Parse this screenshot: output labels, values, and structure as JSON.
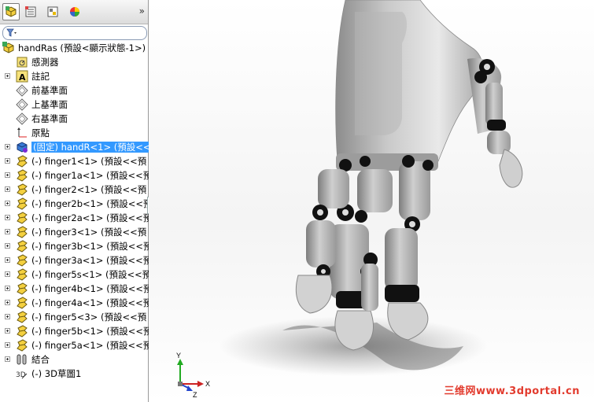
{
  "feature_manager": {
    "tabs": [
      {
        "name": "feature-tree-tab-icon"
      },
      {
        "name": "property-tab-icon"
      },
      {
        "name": "configuration-tab-icon"
      },
      {
        "name": "display-tab-icon"
      }
    ],
    "expand_label": "»",
    "tree": [
      {
        "label": "handRas  (預設<顯示狀態-1>)",
        "icon": "assembly-icon",
        "indent": 0,
        "expand": false
      },
      {
        "label": "感測器",
        "icon": "sensor-icon",
        "indent": 1,
        "expand": false
      },
      {
        "label": "註記",
        "icon": "annotation-icon",
        "indent": 1,
        "expand": true
      },
      {
        "label": "前基準面",
        "icon": "plane-icon",
        "indent": 1,
        "expand": false
      },
      {
        "label": "上基準面",
        "icon": "plane-icon",
        "indent": 1,
        "expand": false
      },
      {
        "label": "右基準面",
        "icon": "plane-icon",
        "indent": 1,
        "expand": false
      },
      {
        "label": "原點",
        "icon": "origin-icon",
        "indent": 1,
        "expand": false
      },
      {
        "label": "(固定) handR<1> (預設<<",
        "icon": "part-blue-icon",
        "indent": 1,
        "expand": true,
        "selected": true
      },
      {
        "label": "(-) finger1<1> (預設<<預",
        "icon": "part-icon",
        "indent": 1,
        "expand": true
      },
      {
        "label": "(-) finger1a<1> (預設<<預",
        "icon": "part-icon",
        "indent": 1,
        "expand": true
      },
      {
        "label": "(-) finger2<1> (預設<<預",
        "icon": "part-icon",
        "indent": 1,
        "expand": true
      },
      {
        "label": "(-) finger2b<1> (預設<<預",
        "icon": "part-icon",
        "indent": 1,
        "expand": true
      },
      {
        "label": "(-) finger2a<1> (預設<<預",
        "icon": "part-icon",
        "indent": 1,
        "expand": true
      },
      {
        "label": "(-) finger3<1> (預設<<預",
        "icon": "part-icon",
        "indent": 1,
        "expand": true
      },
      {
        "label": "(-) finger3b<1> (預設<<預",
        "icon": "part-icon",
        "indent": 1,
        "expand": true
      },
      {
        "label": "(-) finger3a<1> (預設<<預",
        "icon": "part-icon",
        "indent": 1,
        "expand": true
      },
      {
        "label": "(-) finger5s<1> (預設<<預",
        "icon": "part-icon",
        "indent": 1,
        "expand": true
      },
      {
        "label": "(-) finger4b<1> (預設<<預",
        "icon": "part-icon",
        "indent": 1,
        "expand": true
      },
      {
        "label": "(-) finger4a<1> (預設<<預",
        "icon": "part-icon",
        "indent": 1,
        "expand": true
      },
      {
        "label": "(-) finger5<3> (預設<<預",
        "icon": "part-icon",
        "indent": 1,
        "expand": true
      },
      {
        "label": "(-) finger5b<1> (預設<<預",
        "icon": "part-icon",
        "indent": 1,
        "expand": true
      },
      {
        "label": "(-) finger5a<1> (預設<<預",
        "icon": "part-icon",
        "indent": 1,
        "expand": true
      },
      {
        "label": "結合",
        "icon": "mates-icon",
        "indent": 1,
        "expand": true
      },
      {
        "label": "(-) 3D草圖1",
        "icon": "sketch3d-icon",
        "indent": 1,
        "expand": false
      }
    ]
  },
  "viewport": {
    "triad": {
      "x_label": "X",
      "y_label": "Y",
      "z_label": "Z"
    },
    "watermark": "三维网www.3dportal.cn"
  },
  "colors": {
    "selection": "#3399ff",
    "hand": "#c8c8c8",
    "joint": "#111111",
    "triad_x": "#cc2222",
    "triad_y": "#22aa22",
    "triad_z": "#2244cc",
    "watermark": "#e23b2e"
  }
}
